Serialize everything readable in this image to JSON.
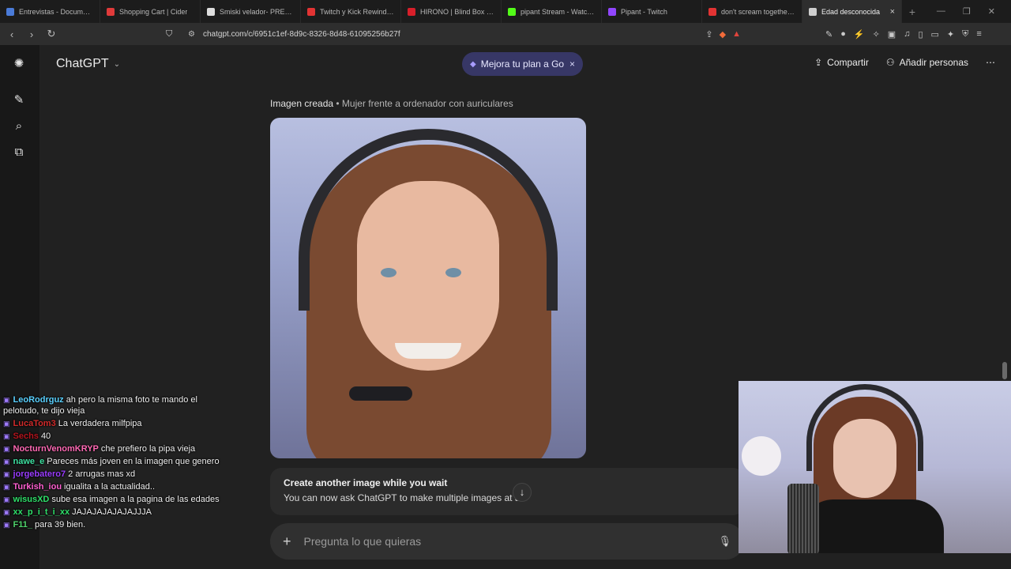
{
  "browser": {
    "tabs": [
      {
        "title": "Entrevistas - Documentos",
        "color": "#4a7bd8"
      },
      {
        "title": "Shopping Cart | Cider",
        "color": "#e03a3a"
      },
      {
        "title": "Smiski velador- PREVENTA",
        "color": "#dddddd"
      },
      {
        "title": "Twitch y Kick Rewind Arge",
        "color": "#e23333"
      },
      {
        "title": "HIRONO | Blind Box - POP",
        "color": "#d81f2a"
      },
      {
        "title": "pipant Stream - Watch Live",
        "color": "#53fc18"
      },
      {
        "title": "Pipant - Twitch",
        "color": "#9146ff"
      },
      {
        "title": "don't scream together gam",
        "color": "#e23333"
      },
      {
        "title": "Edad desconocida",
        "color": "#cfcfcf",
        "active": true
      }
    ],
    "url": "chatgpt.com/c/6951c1ef-8d9c-8326-8d48-61095256b27f",
    "new_tab": "+"
  },
  "header": {
    "model": "ChatGPT",
    "upgrade_label": "Mejora tu plan a Go",
    "share_label": "Compartir",
    "add_people_label": "Añadir personas"
  },
  "content": {
    "caption_strong": "Imagen creada",
    "caption_rest": " • Mujer frente a ordenador con auriculares",
    "notice_title": "Create another image while you wait",
    "notice_body": "You can now ask ChatGPT to make multiple images at a t"
  },
  "composer": {
    "placeholder": "Pregunta lo que quieras"
  },
  "chat": [
    {
      "user": "LeoRodrguz",
      "color": "#5ad1ff",
      "text": "ah pero la misma foto te mando el pelotudo, te dijo vieja"
    },
    {
      "user": "LucaTom3",
      "color": "#d12a2a",
      "text": "La verdadera milfpipa"
    },
    {
      "user": "Sechs",
      "color": "#b3141d",
      "text": "40"
    },
    {
      "user": "NocturnVenomKRYP",
      "color": "#ff69b4",
      "text": "che prefiero la pipa vieja"
    },
    {
      "user": "nawe_e",
      "color": "#3ee0a0",
      "text": "Pareces más joven en la imagen que genero"
    },
    {
      "user": "jorgebatero7",
      "color": "#9a3cff",
      "text": "2 arrugas mas xd"
    },
    {
      "user": "Turkish_iou",
      "color": "#ff5fd0",
      "text": "igualita a la actualidad.."
    },
    {
      "user": "wisusXD",
      "color": "#2fe06a",
      "text": "sube esa imagen a la pagina de las edades"
    },
    {
      "user": "xx_p_i_t_i_xx",
      "color": "#2fe06a",
      "text": "JAJAJAJAJAJAJJJA"
    },
    {
      "user": "F11_",
      "color": "#4fd36b",
      "text": "para 39 bien."
    }
  ]
}
